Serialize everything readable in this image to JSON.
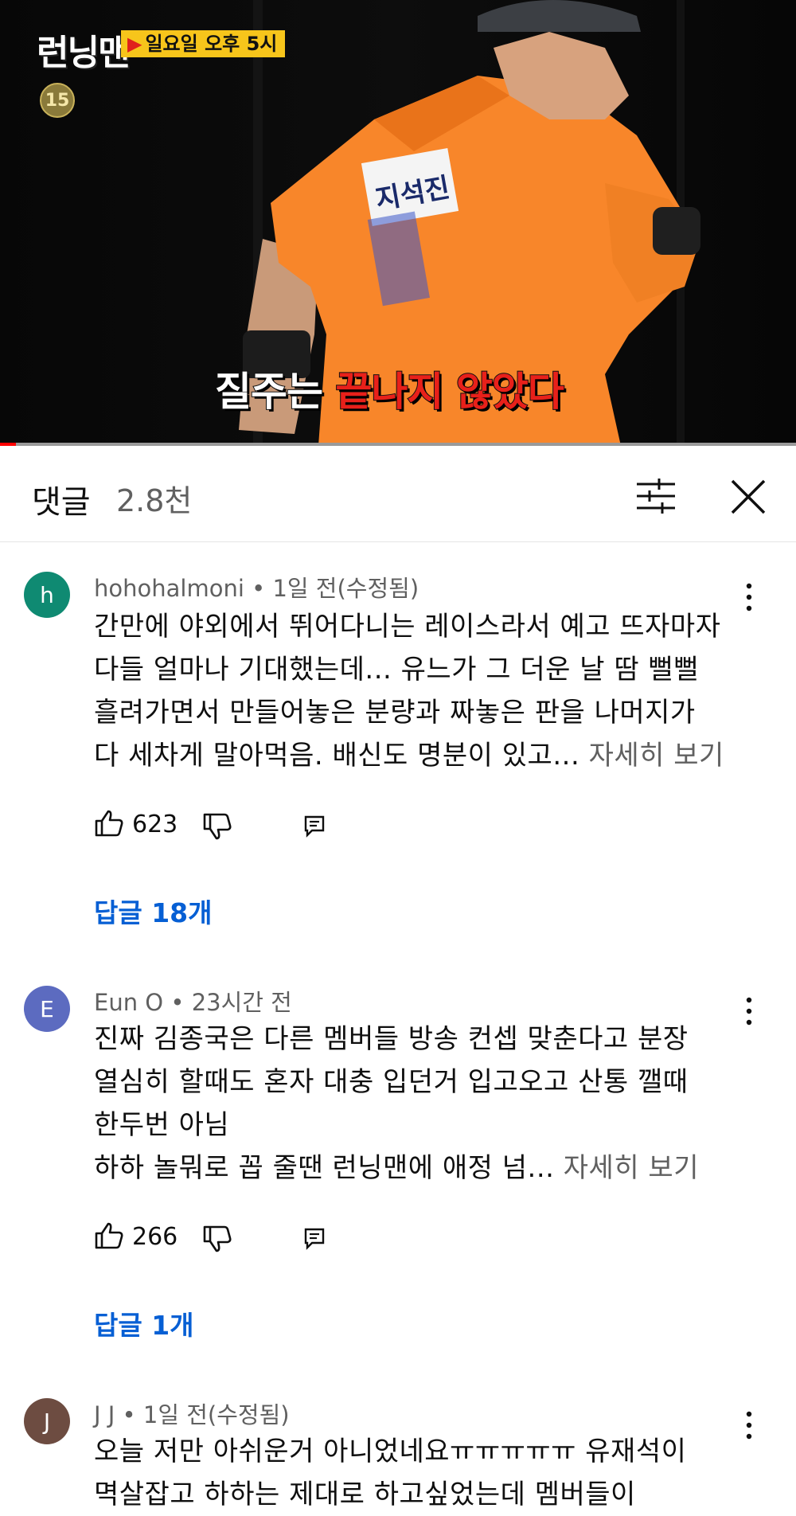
{
  "video": {
    "show_logo": "런닝맨",
    "airtime": "일요일 오후 5시",
    "rating": "15",
    "jersey_name": "지석진",
    "caption_white": "질주는 ",
    "caption_red": "끝나지 않았다",
    "progress": 0.02,
    "colors": {
      "progress": "#ff0000",
      "shirt": "#f8862a",
      "caption_red": "#e8201a"
    }
  },
  "comments_header": {
    "title": "댓글",
    "count": "2.8천",
    "filter_icon": "sort-filter-icon",
    "close_icon": "close-icon"
  },
  "comments": [
    {
      "avatar_letter": "h",
      "avatar_color": "#0f8a72",
      "author": "hohohalmoni",
      "time": "1일 전(수정됨)",
      "lines": [
        "간만에 야외에서 뛰어다니는 레이스라서 예고 뜨자마자",
        "다들 얼마나 기대했는데... 유느가 그 더운 날 땀 뻘뻘",
        "흘려가면서 만들어놓은 분량과 짜놓은 판을 나머지가",
        "다 세차게 말아먹음. 배신도 명분이 있고... "
      ],
      "read_more": "자세히 보기",
      "likes": "623",
      "replies": "답글 18개"
    },
    {
      "avatar_letter": "E",
      "avatar_color": "#5c6bc0",
      "author": "Eun O",
      "time": "23시간 전",
      "lines": [
        "진짜 김종국은 다른 멤버들 방송 컨셉 맞춘다고 분장",
        "열심히 할때도 혼자 대충 입던거 입고오고 산통 깰때",
        "한두번 아님",
        "하하 놀뭐로 꼽 줄땐 런닝맨에 애정 넘... "
      ],
      "read_more": "자세히 보기",
      "likes": "266",
      "replies": "답글 1개"
    },
    {
      "avatar_letter": "J",
      "avatar_color": "#6d4c41",
      "author": "J J",
      "time": "1일 전(수정됨)",
      "lines": [
        "오늘 저만 아쉬운거 아니었네요ㅠㅠㅠㅠㅠ 유재석이",
        "멱살잡고 하하는 제대로 하고싶었는데 멤버들이"
      ]
    }
  ]
}
